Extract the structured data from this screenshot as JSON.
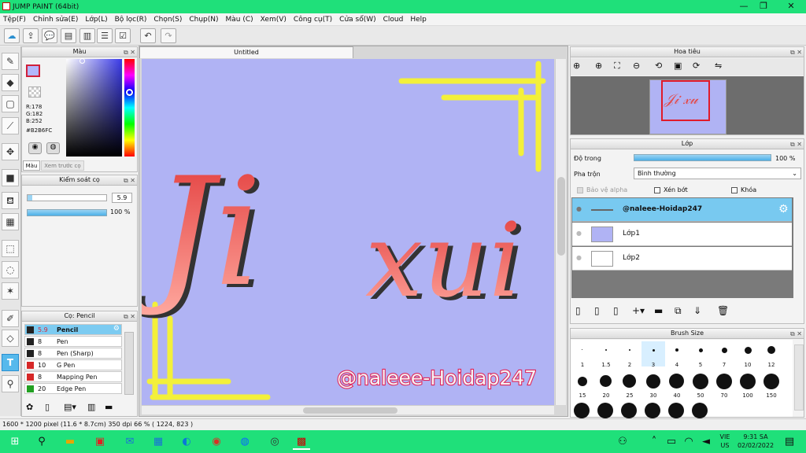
{
  "window": {
    "title": "JUMP PAINT (64bit)"
  },
  "menu": [
    "Tệp(F)",
    "Chỉnh sửa(E)",
    "Lớp(L)",
    "Bộ lọc(R)",
    "Chọn(S)",
    "Chụp(N)",
    "Màu (C)",
    "Xem(V)",
    "Công cụ(T)",
    "Cửa sổ(W)",
    "Cloud",
    "Help"
  ],
  "color_panel": {
    "title": "Màu",
    "r": "R:178",
    "g": "G:182",
    "b": "B:252",
    "hex": "#B2B6FC",
    "tab_color": "Màu",
    "tab_history": "Xem trước cọ",
    "fg": "#b2b6fc",
    "fg_border": "#d0203a"
  },
  "brush_control": {
    "title": "Kiểm soát cọ",
    "size": "5.9",
    "opacity": "100 %",
    "opacity_fraction": 1.0
  },
  "brush_list": {
    "title": "Cọ: Pencil",
    "items": [
      {
        "size": "5.9",
        "name": "Pencil",
        "color": "#222222",
        "selected": true
      },
      {
        "size": "8",
        "name": "Pen",
        "color": "#222222"
      },
      {
        "size": "8",
        "name": "Pen (Sharp)",
        "color": "#222222"
      },
      {
        "size": "10",
        "name": "G Pen",
        "color": "#d62828"
      },
      {
        "size": "8",
        "name": "Mapping Pen",
        "color": "#d62828"
      },
      {
        "size": "20",
        "name": "Edge Pen",
        "color": "#22a022"
      }
    ]
  },
  "document": {
    "tab": "Untitled",
    "watermark": "@naleee-Hoidap247",
    "art_text_left": "Ji",
    "art_text_right": "xui"
  },
  "navigator": {
    "title": "Hoa tiêu"
  },
  "layer_panel": {
    "title": "Lớp",
    "opacity_label": "Độ trong",
    "opacity_value": "100 %",
    "opacity_fraction": 1.0,
    "blend_label": "Pha trộn",
    "blend_value": "Bình thường",
    "protect_alpha": "Bảo vệ alpha",
    "clipping": "Xén bớt",
    "lock": "Khóa",
    "layers": [
      {
        "name": "@naleee-Hoidap247",
        "selected": true
      },
      {
        "name": "Lớp1"
      },
      {
        "name": "Lớp2"
      }
    ]
  },
  "brush_size": {
    "title": "Brush Size",
    "row1": [
      "1",
      "1.5",
      "2",
      "3",
      "4",
      "5",
      "7",
      "10",
      "12"
    ],
    "row2": [
      "15",
      "20",
      "25",
      "30",
      "40",
      "50",
      "70",
      "100",
      "150"
    ]
  },
  "status": {
    "text": "1600 * 1200 pixel  (11.6 * 8.7cm)  350 dpi  66 %  ( 1224, 823 )"
  },
  "taskbar": {
    "lang1": "VIE",
    "lang2": "US",
    "time": "9:31 SA",
    "date": "02/02/2022"
  }
}
